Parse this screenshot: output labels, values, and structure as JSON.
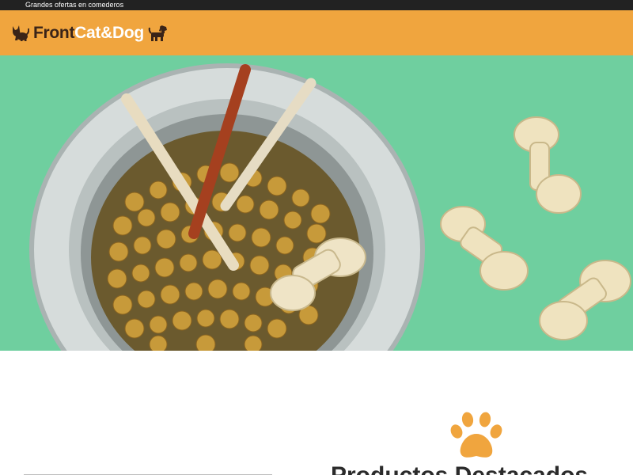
{
  "promo_bar": {
    "text": "Grandes ofertas en comederos"
  },
  "header": {
    "brand_part1": "Front",
    "brand_part2": "Cat&Dog",
    "left_icon": "cat-icon",
    "right_icon": "dog-icon"
  },
  "hero": {
    "image": "food-bowl-with-kibble-and-chew-bones"
  },
  "section": {
    "icon": "paw-icon",
    "title": "Productos Destacados"
  },
  "colors": {
    "promo_bar_bg": "#222222",
    "header_bg": "#f0a53e",
    "brand_dark": "#3a2418",
    "brand_light": "#ffffff",
    "hero_bg": "#6fcf9f",
    "paw": "#f0a53e"
  }
}
